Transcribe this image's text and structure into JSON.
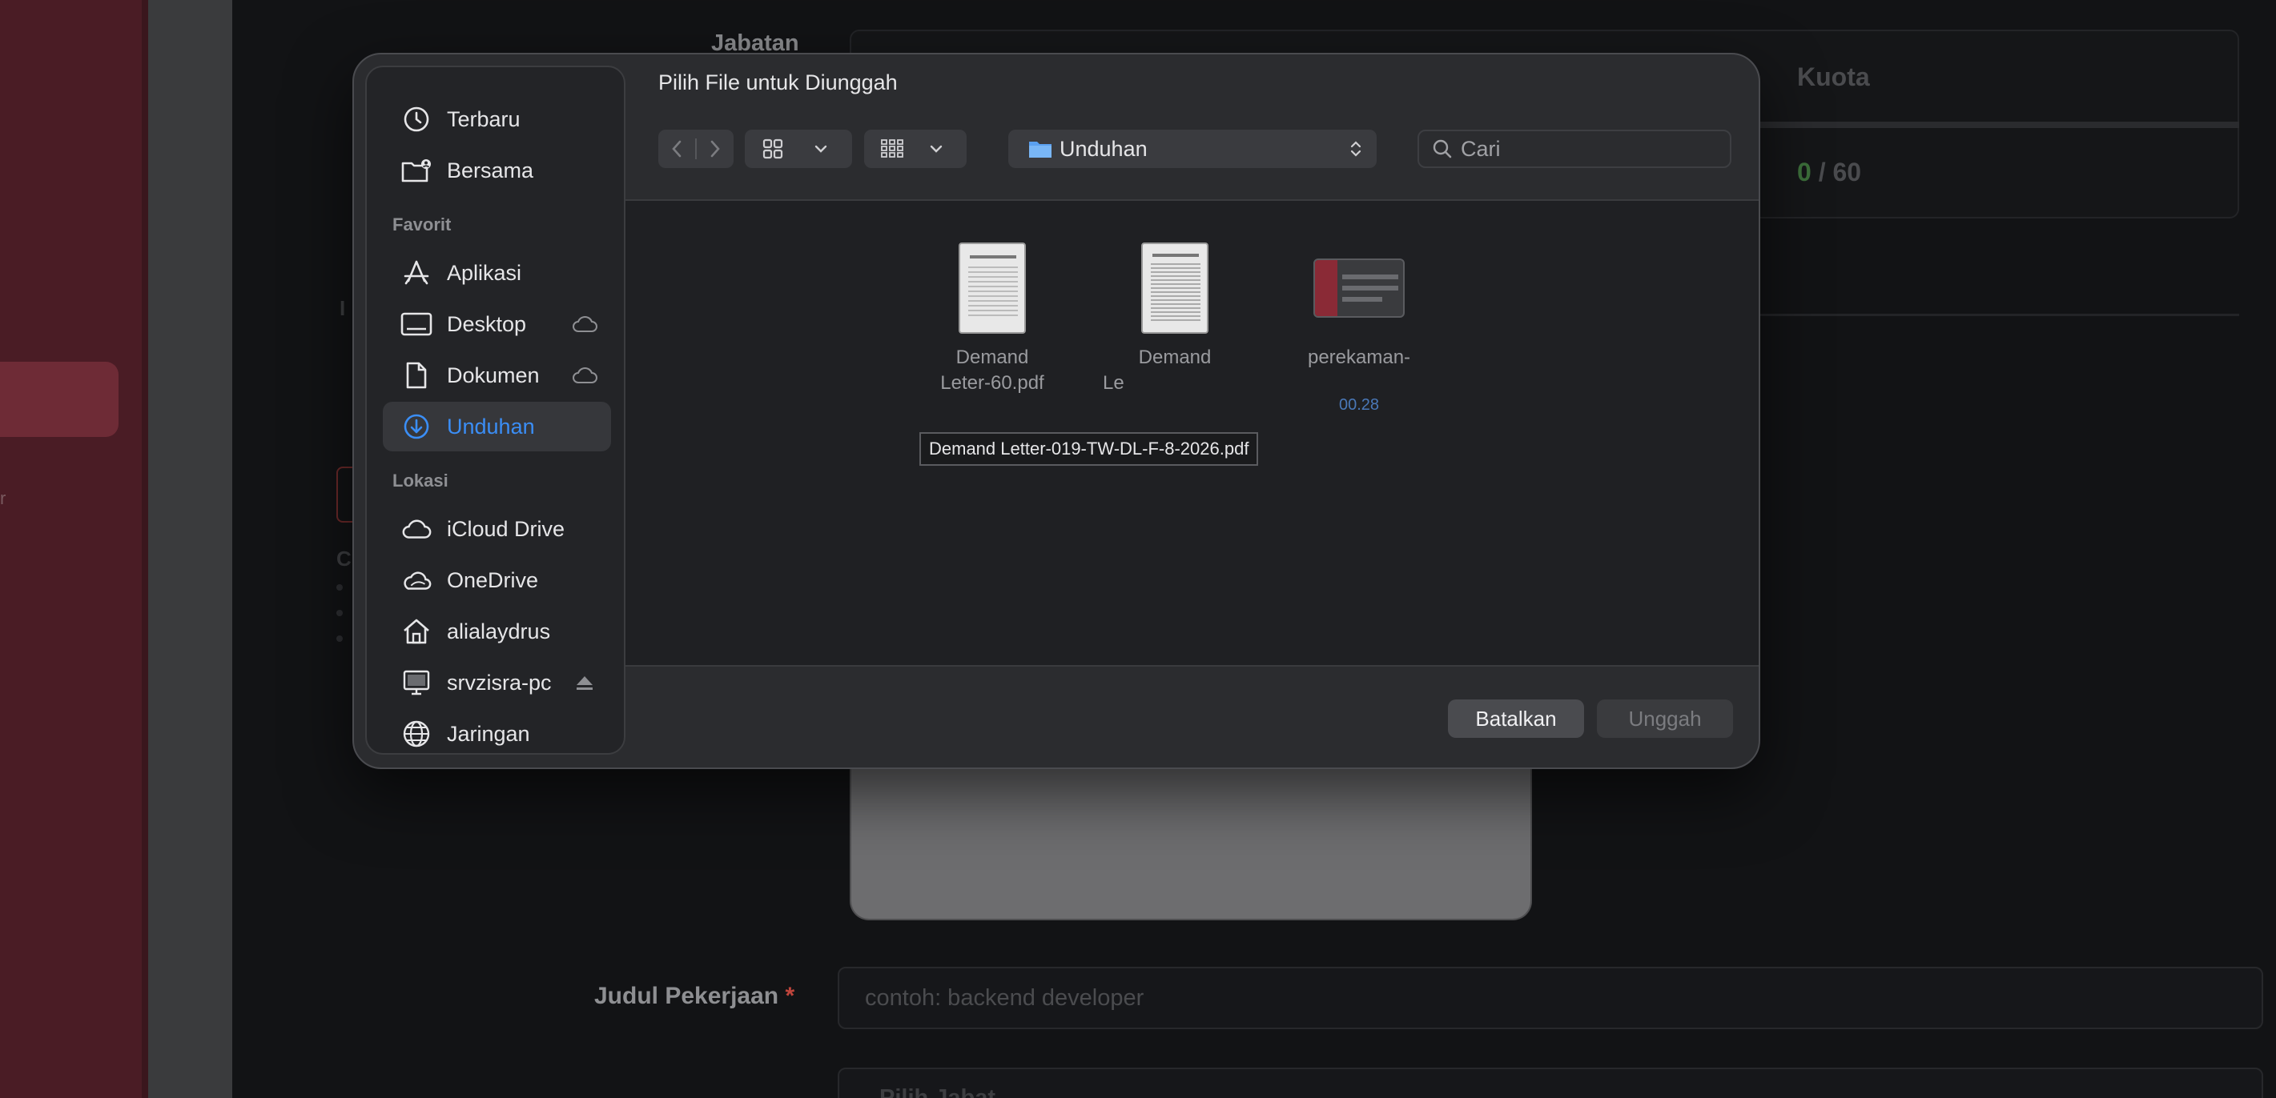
{
  "background": {
    "left_stub_text": "r",
    "jabatan_label": "Jabatan",
    "kuota_header": "Kuota",
    "kuota_filled": "0",
    "kuota_sep": "/",
    "kuota_total": "60",
    "mini_label": "C",
    "mini_label_2": "I",
    "form": {
      "job_title_label": "Judul Pekerjaan",
      "required_mark": "*",
      "job_title_placeholder": "contoh: backend developer",
      "next_field_text": "Pilih Jabat..."
    }
  },
  "dialog": {
    "title": "Pilih File untuk Diunggah",
    "location": "Unduhan",
    "search_placeholder": "Cari",
    "sidebar": {
      "top_items": [
        {
          "label": "Terbaru",
          "icon": "clock-icon"
        },
        {
          "label": "Bersama",
          "icon": "shared-folder-icon"
        }
      ],
      "favorites_heading": "Favorit",
      "favorites": [
        {
          "label": "Aplikasi",
          "icon": "apps-icon"
        },
        {
          "label": "Desktop",
          "icon": "desktop-icon"
        },
        {
          "label": "Dokumen",
          "icon": "document-icon"
        },
        {
          "label": "Unduhan",
          "icon": "download-icon",
          "active": true
        }
      ],
      "locations_heading": "Lokasi",
      "locations": [
        {
          "label": "iCloud Drive",
          "icon": "icloud-icon"
        },
        {
          "label": "OneDrive",
          "icon": "onedrive-icon"
        },
        {
          "label": "alialaydrus",
          "icon": "home-icon"
        },
        {
          "label": "srvzisra-pc",
          "icon": "computer-icon"
        },
        {
          "label": "Jaringan",
          "icon": "network-icon"
        }
      ]
    },
    "files": [
      {
        "line1": "Demand",
        "line2": "Leter-60.pdf"
      },
      {
        "line1": "Demand",
        "line2": "Le"
      },
      {
        "line1": "perekaman-",
        "line2": "",
        "meta": "00.28"
      }
    ],
    "tooltip": "Demand Letter-019-TW-DL-F-8-2026.pdf",
    "buttons": {
      "cancel": "Batalkan",
      "upload": "Unggah"
    },
    "colors": {
      "accent": "#3b8ef6",
      "dialog_bg": "#2b2c2f"
    }
  }
}
